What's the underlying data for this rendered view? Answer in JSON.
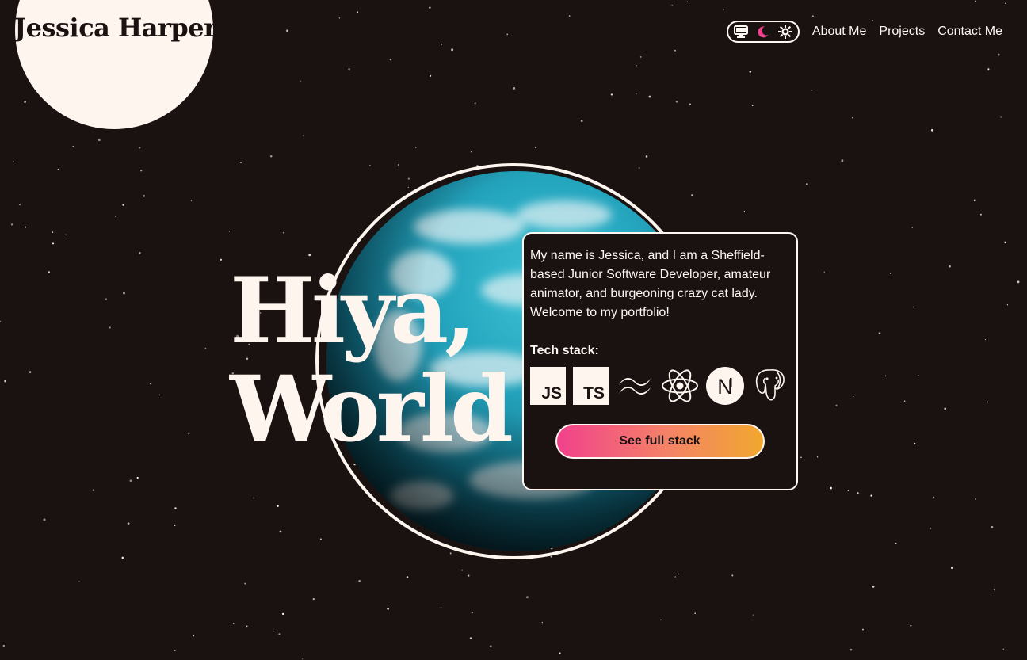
{
  "header": {
    "logo": "Jessica Harper",
    "theme_toggle": [
      {
        "name": "system",
        "icon": "monitor-icon"
      },
      {
        "name": "dark",
        "icon": "moon-icon",
        "active": true,
        "color": "#f1418c"
      },
      {
        "name": "light",
        "icon": "sun-icon"
      }
    ],
    "nav": [
      "About Me",
      "Projects",
      "Contact Me"
    ]
  },
  "hero": {
    "line1": "Hiya,",
    "line2": "World"
  },
  "card": {
    "intro": "My name is Jessica, and I am a Sheffield-based Junior Software Developer, amateur animator, and burgeoning crazy cat lady. Welcome to my portfolio!",
    "stack_heading": "Tech stack:",
    "tech": [
      {
        "icon": "javascript-icon",
        "label": "JS"
      },
      {
        "icon": "typescript-icon",
        "label": "TS"
      },
      {
        "icon": "tailwind-icon"
      },
      {
        "icon": "react-icon"
      },
      {
        "icon": "nextjs-icon",
        "label": "N"
      },
      {
        "icon": "postgresql-icon"
      }
    ],
    "cta": "See full stack"
  },
  "colors": {
    "background": "#191211",
    "cream": "#fff5ef",
    "accent_pink": "#f1418c",
    "accent_orange": "#f0a72e",
    "planet": "#25a6bf"
  }
}
